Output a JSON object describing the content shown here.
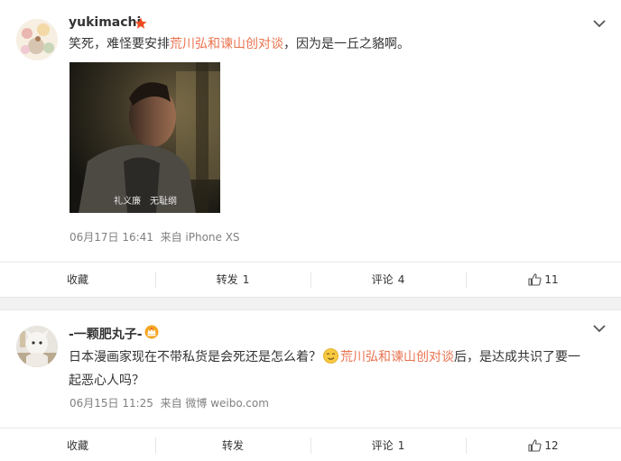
{
  "posts": [
    {
      "username": "yukimachi",
      "text_before": "笑死，难怪要安排",
      "topic": "荒川弘和谏山创对谈",
      "text_after": "，因为是一丘之貉啊。",
      "image_caption": "礼义廉　无耻纲",
      "meta": {
        "date": "06月17日 16:41",
        "source": "来自 iPhone XS"
      },
      "actions": {
        "favorite": "收藏",
        "repost": "转发",
        "repost_count": "1",
        "comment": "评论",
        "comment_count": "4",
        "like_count": "11"
      }
    },
    {
      "username": "-一颗肥丸子-",
      "text_before": "日本漫画家现在不带私货是会死还是怎么着？",
      "topic": "荒川弘和谏山创对谈",
      "text_after": "后，是达成共识了要一起恶心人吗？",
      "meta": {
        "date": "06月15日 11:25",
        "source": "来自 微博 weibo.com"
      },
      "actions": {
        "favorite": "收藏",
        "repost": "转发",
        "comment": "评论",
        "comment_count": "1",
        "like_count": "12"
      }
    }
  ],
  "colors": {
    "topic": "#eb7350",
    "meta": "#808080",
    "badge_red": "#f04b1e",
    "crown_gold": "#f6a623"
  },
  "icons": [
    "chevron-down-icon",
    "thumbs-up-icon",
    "member-star-icon",
    "crown-badge-icon",
    "smirk-emoji-icon"
  ]
}
